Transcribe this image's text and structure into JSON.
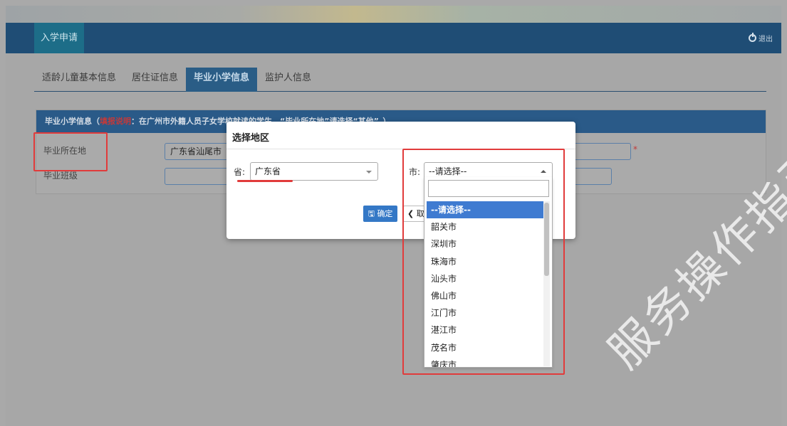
{
  "topbar": {
    "title": "入学申请",
    "logout_label": "退出"
  },
  "tabs": [
    {
      "label": "适龄儿童基本信息",
      "active": false
    },
    {
      "label": "居住证信息",
      "active": false
    },
    {
      "label": "毕业小学信息",
      "active": true
    },
    {
      "label": "监护人信息",
      "active": false
    }
  ],
  "panel": {
    "title_start": "毕业小学信息（",
    "title_red": "填报说明",
    "title_rest": "：在广州市外籍人员子女学校就读的学生，“毕业所在地”请选择“其他”。）",
    "fields": [
      {
        "label": "毕业所在地",
        "value": "广东省汕尾市"
      },
      {
        "label": "毕业班级",
        "value": ""
      }
    ],
    "required_mark": "*"
  },
  "modal": {
    "title": "选择地区",
    "province_label": "省:",
    "province_value": "广东省",
    "city_label": "市:",
    "city_value": "--请选择--",
    "ok_label": "确定",
    "cancel_label": "取消"
  },
  "dropdown": {
    "search_value": "",
    "items": [
      "--请选择--",
      "韶关市",
      "深圳市",
      "珠海市",
      "汕头市",
      "佛山市",
      "江门市",
      "湛江市",
      "茂名市",
      "肇庆市"
    ],
    "selected_index": 0
  },
  "watermark": "服务操作指引",
  "colors": {
    "accent": "#3f7bd1",
    "highlight": "#e13b3b",
    "header": "#1f4d75"
  }
}
